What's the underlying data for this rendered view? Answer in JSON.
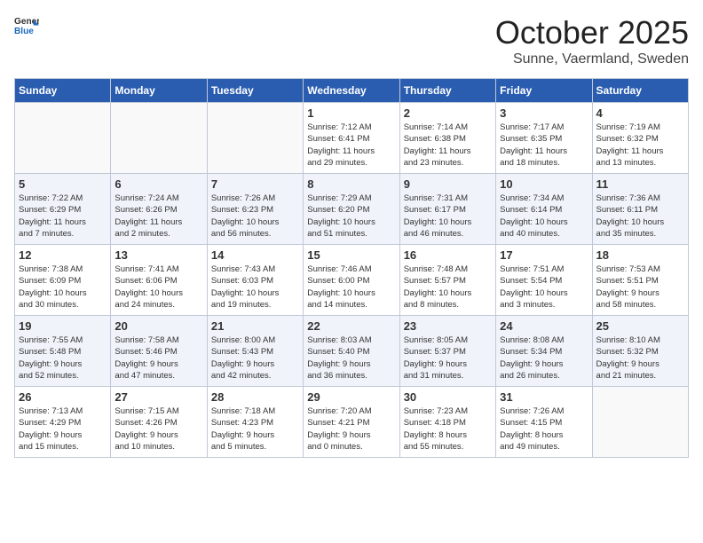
{
  "header": {
    "logo_general": "General",
    "logo_blue": "Blue",
    "month_title": "October 2025",
    "subtitle": "Sunne, Vaermland, Sweden"
  },
  "days_of_week": [
    "Sunday",
    "Monday",
    "Tuesday",
    "Wednesday",
    "Thursday",
    "Friday",
    "Saturday"
  ],
  "weeks": [
    [
      {
        "day": "",
        "info": ""
      },
      {
        "day": "",
        "info": ""
      },
      {
        "day": "",
        "info": ""
      },
      {
        "day": "1",
        "info": "Sunrise: 7:12 AM\nSunset: 6:41 PM\nDaylight: 11 hours\nand 29 minutes."
      },
      {
        "day": "2",
        "info": "Sunrise: 7:14 AM\nSunset: 6:38 PM\nDaylight: 11 hours\nand 23 minutes."
      },
      {
        "day": "3",
        "info": "Sunrise: 7:17 AM\nSunset: 6:35 PM\nDaylight: 11 hours\nand 18 minutes."
      },
      {
        "day": "4",
        "info": "Sunrise: 7:19 AM\nSunset: 6:32 PM\nDaylight: 11 hours\nand 13 minutes."
      }
    ],
    [
      {
        "day": "5",
        "info": "Sunrise: 7:22 AM\nSunset: 6:29 PM\nDaylight: 11 hours\nand 7 minutes."
      },
      {
        "day": "6",
        "info": "Sunrise: 7:24 AM\nSunset: 6:26 PM\nDaylight: 11 hours\nand 2 minutes."
      },
      {
        "day": "7",
        "info": "Sunrise: 7:26 AM\nSunset: 6:23 PM\nDaylight: 10 hours\nand 56 minutes."
      },
      {
        "day": "8",
        "info": "Sunrise: 7:29 AM\nSunset: 6:20 PM\nDaylight: 10 hours\nand 51 minutes."
      },
      {
        "day": "9",
        "info": "Sunrise: 7:31 AM\nSunset: 6:17 PM\nDaylight: 10 hours\nand 46 minutes."
      },
      {
        "day": "10",
        "info": "Sunrise: 7:34 AM\nSunset: 6:14 PM\nDaylight: 10 hours\nand 40 minutes."
      },
      {
        "day": "11",
        "info": "Sunrise: 7:36 AM\nSunset: 6:11 PM\nDaylight: 10 hours\nand 35 minutes."
      }
    ],
    [
      {
        "day": "12",
        "info": "Sunrise: 7:38 AM\nSunset: 6:09 PM\nDaylight: 10 hours\nand 30 minutes."
      },
      {
        "day": "13",
        "info": "Sunrise: 7:41 AM\nSunset: 6:06 PM\nDaylight: 10 hours\nand 24 minutes."
      },
      {
        "day": "14",
        "info": "Sunrise: 7:43 AM\nSunset: 6:03 PM\nDaylight: 10 hours\nand 19 minutes."
      },
      {
        "day": "15",
        "info": "Sunrise: 7:46 AM\nSunset: 6:00 PM\nDaylight: 10 hours\nand 14 minutes."
      },
      {
        "day": "16",
        "info": "Sunrise: 7:48 AM\nSunset: 5:57 PM\nDaylight: 10 hours\nand 8 minutes."
      },
      {
        "day": "17",
        "info": "Sunrise: 7:51 AM\nSunset: 5:54 PM\nDaylight: 10 hours\nand 3 minutes."
      },
      {
        "day": "18",
        "info": "Sunrise: 7:53 AM\nSunset: 5:51 PM\nDaylight: 9 hours\nand 58 minutes."
      }
    ],
    [
      {
        "day": "19",
        "info": "Sunrise: 7:55 AM\nSunset: 5:48 PM\nDaylight: 9 hours\nand 52 minutes."
      },
      {
        "day": "20",
        "info": "Sunrise: 7:58 AM\nSunset: 5:46 PM\nDaylight: 9 hours\nand 47 minutes."
      },
      {
        "day": "21",
        "info": "Sunrise: 8:00 AM\nSunset: 5:43 PM\nDaylight: 9 hours\nand 42 minutes."
      },
      {
        "day": "22",
        "info": "Sunrise: 8:03 AM\nSunset: 5:40 PM\nDaylight: 9 hours\nand 36 minutes."
      },
      {
        "day": "23",
        "info": "Sunrise: 8:05 AM\nSunset: 5:37 PM\nDaylight: 9 hours\nand 31 minutes."
      },
      {
        "day": "24",
        "info": "Sunrise: 8:08 AM\nSunset: 5:34 PM\nDaylight: 9 hours\nand 26 minutes."
      },
      {
        "day": "25",
        "info": "Sunrise: 8:10 AM\nSunset: 5:32 PM\nDaylight: 9 hours\nand 21 minutes."
      }
    ],
    [
      {
        "day": "26",
        "info": "Sunrise: 7:13 AM\nSunset: 4:29 PM\nDaylight: 9 hours\nand 15 minutes."
      },
      {
        "day": "27",
        "info": "Sunrise: 7:15 AM\nSunset: 4:26 PM\nDaylight: 9 hours\nand 10 minutes."
      },
      {
        "day": "28",
        "info": "Sunrise: 7:18 AM\nSunset: 4:23 PM\nDaylight: 9 hours\nand 5 minutes."
      },
      {
        "day": "29",
        "info": "Sunrise: 7:20 AM\nSunset: 4:21 PM\nDaylight: 9 hours\nand 0 minutes."
      },
      {
        "day": "30",
        "info": "Sunrise: 7:23 AM\nSunset: 4:18 PM\nDaylight: 8 hours\nand 55 minutes."
      },
      {
        "day": "31",
        "info": "Sunrise: 7:26 AM\nSunset: 4:15 PM\nDaylight: 8 hours\nand 49 minutes."
      },
      {
        "day": "",
        "info": ""
      }
    ]
  ]
}
